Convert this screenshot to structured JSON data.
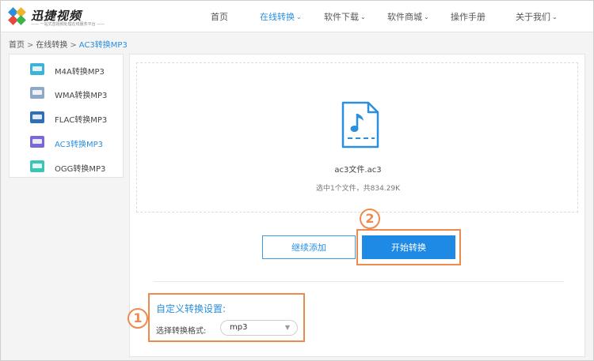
{
  "header": {
    "brand": {
      "title": "迅捷视频",
      "subtitle": "—— 一站式音视频处理在线服务平台 ——"
    },
    "nav": [
      {
        "label": "首页",
        "has_menu": false,
        "active": false
      },
      {
        "label": "在线转换",
        "has_menu": true,
        "active": true
      },
      {
        "label": "软件下载",
        "has_menu": true,
        "active": false
      },
      {
        "label": "软件商城",
        "has_menu": true,
        "active": false
      },
      {
        "label": "操作手册",
        "has_menu": false,
        "active": false
      },
      {
        "label": "关于我们",
        "has_menu": true,
        "active": false
      }
    ]
  },
  "breadcrumb": {
    "items": [
      "首页",
      "在线转换"
    ],
    "separator": ">",
    "current": "AC3转换MP3"
  },
  "sidebar": {
    "items": [
      {
        "label": "M4A转换MP3",
        "icon_text": "M4A",
        "color": "#3db3d9",
        "active": false
      },
      {
        "label": "WMA转换MP3",
        "icon_text": "WMA",
        "color": "#8fa8c8",
        "active": false
      },
      {
        "label": "FLAC转换MP3",
        "icon_text": "FLAC",
        "color": "#2e6fb8",
        "active": false
      },
      {
        "label": "AC3转换MP3",
        "icon_text": "AC3",
        "color": "#7a68d6",
        "active": true
      },
      {
        "label": "OGG转换MP3",
        "icon_text": "OGG",
        "color": "#3cc4b4",
        "active": false
      }
    ]
  },
  "upload": {
    "file_name": "ac3文件.ac3",
    "summary": "选中1个文件，共834.29K"
  },
  "actions": {
    "add_label": "继续添加",
    "start_label": "开始转换"
  },
  "annotations": {
    "step1": "1",
    "step2": "2"
  },
  "settings": {
    "title": "自定义转换设置:",
    "format_label": "选择转换格式:",
    "format_value": "mp3"
  },
  "colors": {
    "accent": "#2a8fde",
    "primary_button": "#1e8ae6",
    "annotation": "#ef8a4e"
  }
}
